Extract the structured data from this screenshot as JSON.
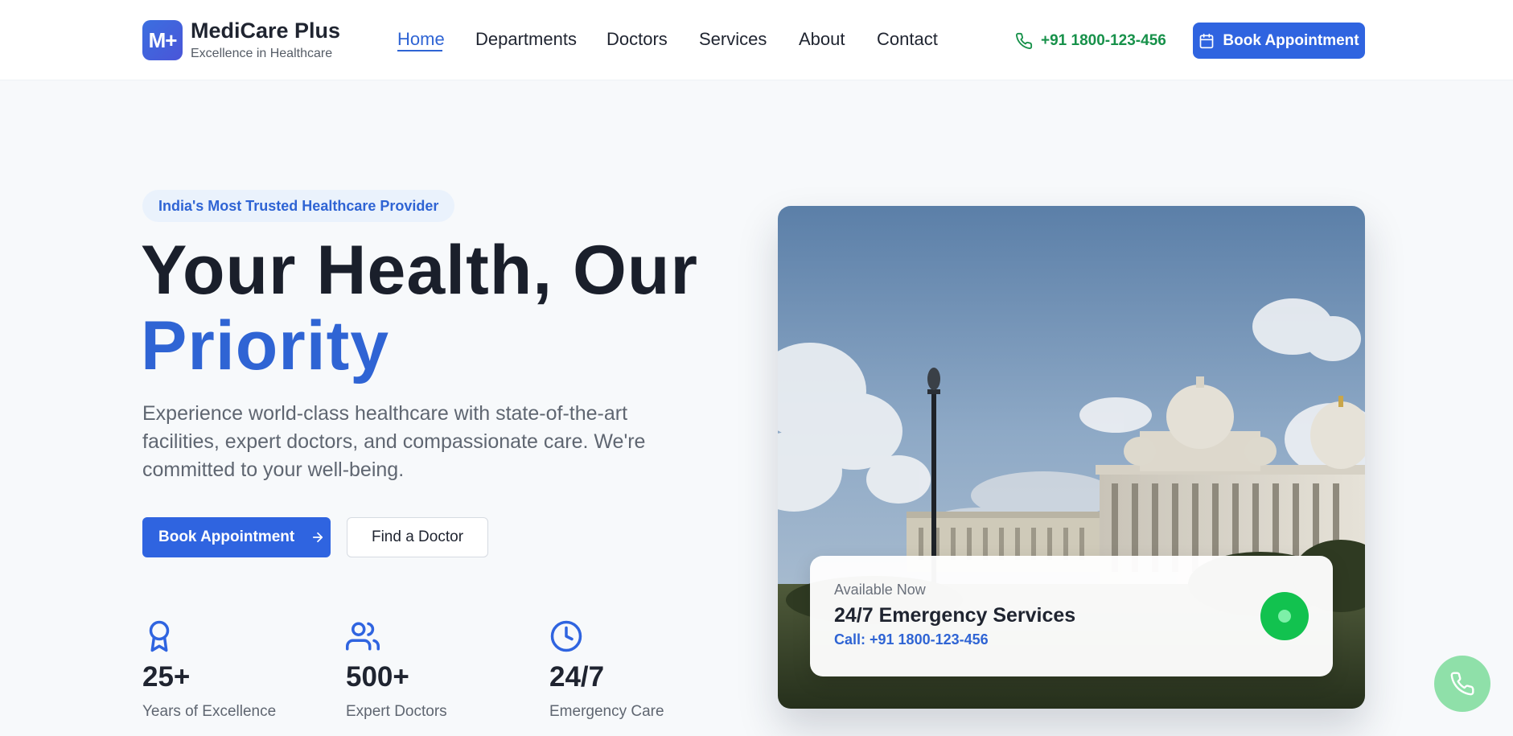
{
  "brand": {
    "logo_text": "M+",
    "name": "MediCare Plus",
    "tagline": "Excellence in Healthcare"
  },
  "nav": {
    "items": [
      {
        "label": "Home",
        "active": true
      },
      {
        "label": "Departments"
      },
      {
        "label": "Doctors"
      },
      {
        "label": "Services"
      },
      {
        "label": "About"
      },
      {
        "label": "Contact"
      }
    ]
  },
  "header": {
    "phone": "+91 1800-123-456",
    "book_label": "Book Appointment"
  },
  "hero": {
    "badge": "India's Most Trusted Healthcare Provider",
    "title_line1": "Your Health, Our",
    "title_line2": "Priority",
    "description": "Experience world-class healthcare with state-of-the-art facilities, expert doctors, and compassionate care. We're committed to your well-being.",
    "primary_cta": "Book Appointment",
    "secondary_cta": "Find a Doctor"
  },
  "stats": [
    {
      "icon": "award-icon",
      "value": "25+",
      "label": "Years of Excellence"
    },
    {
      "icon": "users-icon",
      "value": "500+",
      "label": "Expert Doctors"
    },
    {
      "icon": "clock-icon",
      "value": "24/7",
      "label": "Emergency Care"
    }
  ],
  "emergency_card": {
    "status": "Available Now",
    "title": "24/7 Emergency Services",
    "call": "Call: +91 1800-123-456"
  },
  "colors": {
    "primary": "#2f64e0",
    "accent_green": "#12c24f",
    "phone_green": "#17914a",
    "background": "#f7f9fb"
  }
}
